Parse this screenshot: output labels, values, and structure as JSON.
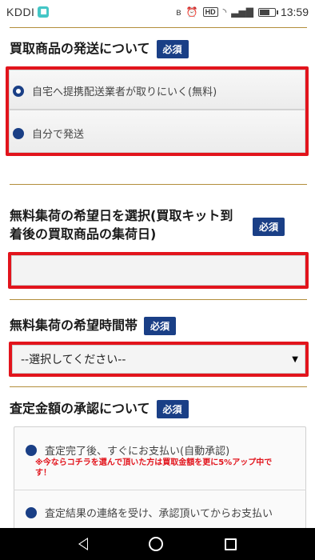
{
  "statusbar": {
    "carrier": "KDDI",
    "carrier_badge": "■",
    "bluetooth": "ʙ",
    "alarm": "⏰",
    "hd": "HD",
    "wifi": "◝",
    "signal": "▃▅▇",
    "battery_level": 0.7,
    "time": "13:59"
  },
  "shipping": {
    "title": "買取商品の発送について",
    "required": "必須",
    "options": [
      {
        "label": "自宅へ提携配送業者が取りにいく(無料)",
        "selected": true
      },
      {
        "label": "自分で発送",
        "selected": false
      }
    ]
  },
  "pickup_date": {
    "title_line1": "無料集荷の希望日を選択(買取キット到",
    "title_line2": "着後の買取商品の集荷日)",
    "required": "必須",
    "value": ""
  },
  "pickup_time": {
    "title": "無料集荷の希望時間帯",
    "required": "必須",
    "select_value": "--選択してください--"
  },
  "approval": {
    "title": "査定金額の承認について",
    "required": "必須",
    "options": [
      {
        "label": "査定完了後、すぐにお支払い(自動承認)",
        "notice_line1": "※今ならコチラを選んで頂いた方は買取金額を更に5%アップ中で",
        "notice_line2": "す！"
      },
      {
        "label": "査定結果の連絡を受け、承認頂いてからお支払い"
      }
    ]
  },
  "colors": {
    "accent_navy": "#1a3f86",
    "highlight_red": "#e2141c",
    "divider_gold": "#b38e3c"
  }
}
